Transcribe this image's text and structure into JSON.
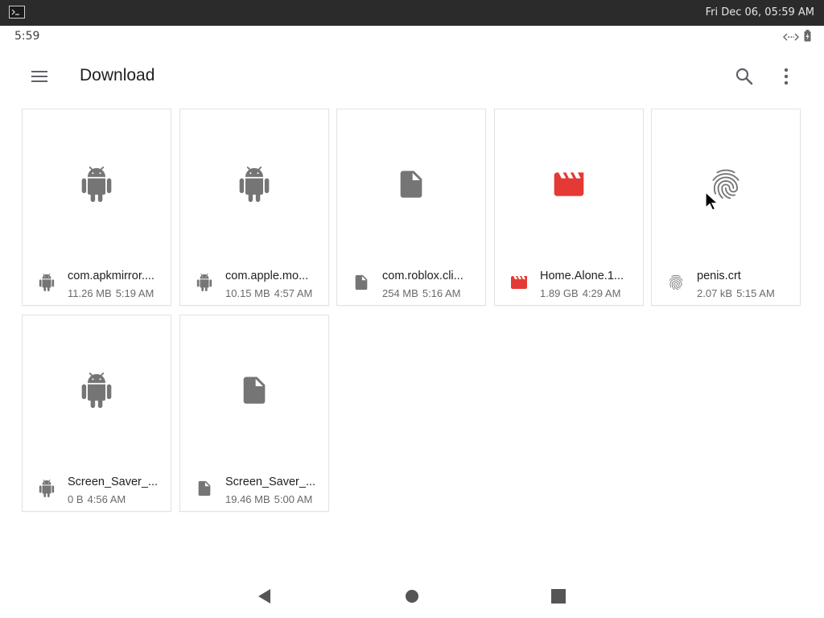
{
  "system_bar": {
    "clock": "Fri Dec 06, 05:59 AM",
    "icon": "terminal-icon"
  },
  "status_bar": {
    "time": "5:59",
    "icons": [
      "link-icon",
      "battery-icon"
    ]
  },
  "app_bar": {
    "title": "Download",
    "icons": {
      "menu": "menu-icon",
      "search": "search-icon",
      "more": "more-vert-icon"
    }
  },
  "files": [
    {
      "name": "com.apkmirror....",
      "size": "11.26 MB",
      "time": "5:19 AM",
      "icon": "android-icon",
      "color": "#757575"
    },
    {
      "name": "com.apple.mo...",
      "size": "10.15 MB",
      "time": "4:57 AM",
      "icon": "android-icon",
      "color": "#757575"
    },
    {
      "name": "com.roblox.cli...",
      "size": "254 MB",
      "time": "5:16 AM",
      "icon": "file-icon",
      "color": "#757575"
    },
    {
      "name": "Home.Alone.1...",
      "size": "1.89 GB",
      "time": "4:29 AM",
      "icon": "video-icon",
      "color": "#e53935"
    },
    {
      "name": "penis.crt",
      "size": "2.07 kB",
      "time": "5:15 AM",
      "icon": "fingerprint-icon",
      "color": "#757575"
    },
    {
      "name": "Screen_Saver_...",
      "size": "0 B",
      "time": "4:56 AM",
      "icon": "android-icon",
      "color": "#757575"
    },
    {
      "name": "Screen_Saver_...",
      "size": "19.46 MB",
      "time": "5:00 AM",
      "icon": "file-icon",
      "color": "#757575"
    }
  ],
  "nav_bar": {
    "back": "back-icon",
    "home": "home-icon",
    "recents": "recents-icon"
  }
}
